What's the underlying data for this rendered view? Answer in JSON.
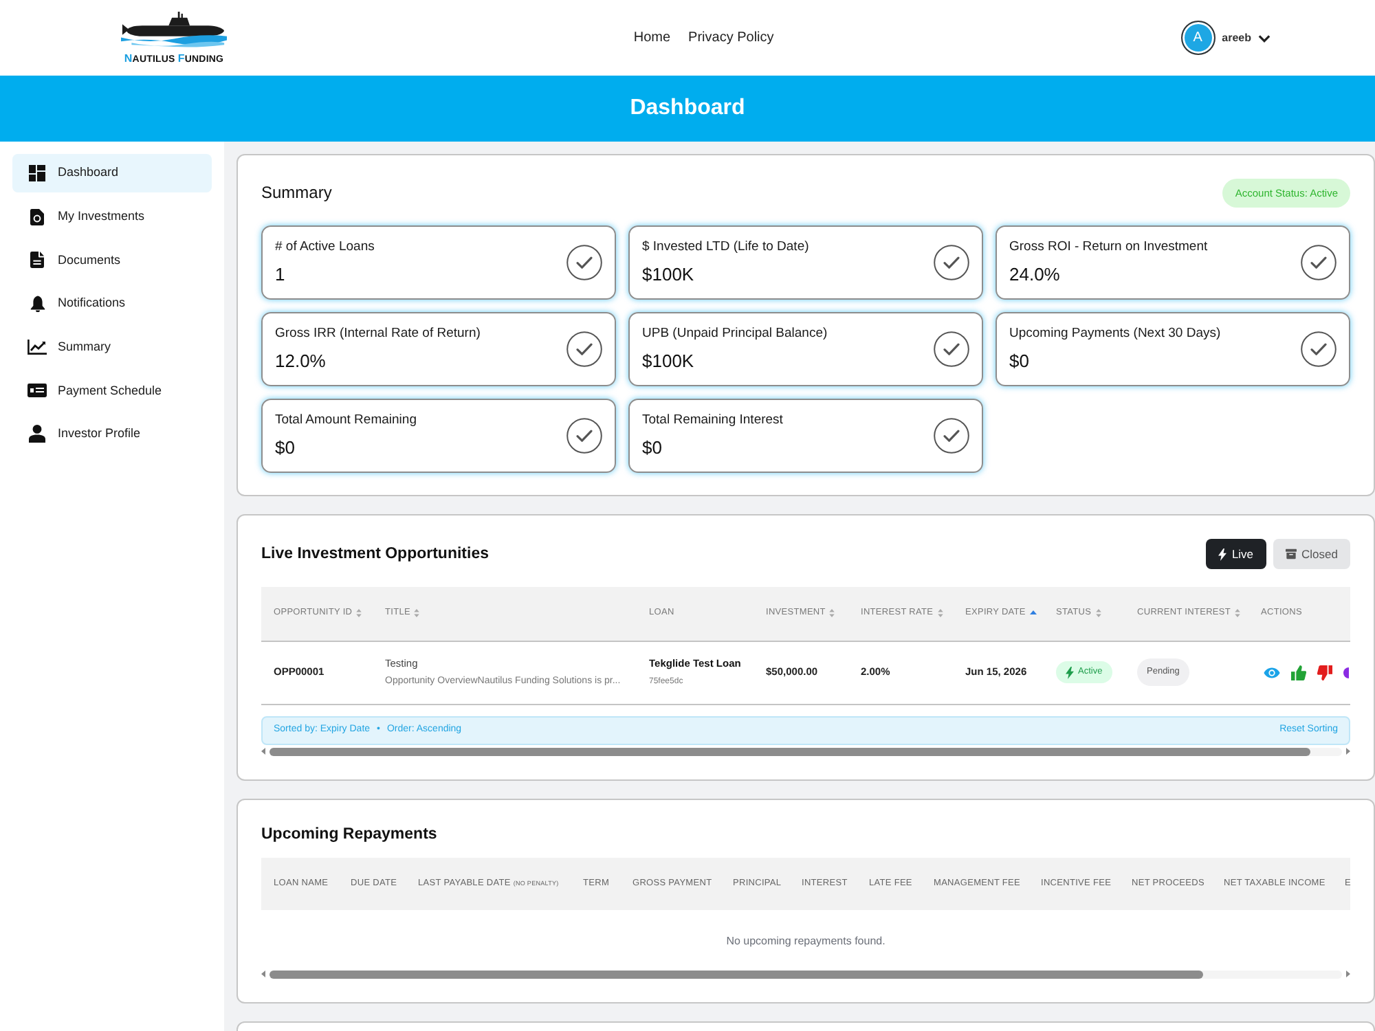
{
  "header": {
    "logo": {
      "words": [
        {
          "initial": "N",
          "rest": "AUTILUS"
        },
        {
          "initial": "F",
          "rest": "UNDING"
        }
      ]
    },
    "nav": [
      {
        "label": "Home"
      },
      {
        "label": "Privacy Policy"
      }
    ],
    "user": {
      "initial": "A",
      "name": "areeb"
    }
  },
  "banner": {
    "title": "Dashboard"
  },
  "sidebar": {
    "items": [
      {
        "label": "Dashboard",
        "selected": true
      },
      {
        "label": "My Investments",
        "selected": false
      },
      {
        "label": "Documents",
        "selected": false
      },
      {
        "label": "Notifications",
        "selected": false
      },
      {
        "label": "Summary",
        "selected": false
      },
      {
        "label": "Payment Schedule",
        "selected": false
      },
      {
        "label": "Investor Profile",
        "selected": false
      }
    ]
  },
  "summary": {
    "title": "Summary",
    "account_status": "Account Status: Active",
    "stats": [
      {
        "label": "# of Active Loans",
        "value": "1"
      },
      {
        "label": "$ Invested LTD (Life to Date)",
        "value": "$100K"
      },
      {
        "label": "Gross ROI - Return on Investment",
        "value": "24.0%"
      },
      {
        "label": "Gross IRR (Internal Rate of Return)",
        "value": "12.0%"
      },
      {
        "label": "UPB (Unpaid Principal Balance)",
        "value": "$100K"
      },
      {
        "label": "Upcoming Payments (Next 30 Days)",
        "value": "$0"
      },
      {
        "label": "Total Amount Remaining",
        "value": "$0"
      },
      {
        "label": "Total Remaining Interest",
        "value": "$0"
      }
    ]
  },
  "live_opportunities": {
    "title": "Live Investment Opportunities",
    "filters": [
      {
        "label": "Live",
        "selected": true
      },
      {
        "label": "Closed",
        "selected": false
      }
    ],
    "columns": [
      {
        "label": "OPPORTUNITY ID",
        "sortable": true,
        "sorted": false
      },
      {
        "label": "TITLE",
        "sortable": true,
        "sorted": false
      },
      {
        "label": "LOAN",
        "sortable": false,
        "sorted": false
      },
      {
        "label": "INVESTMENT",
        "sortable": true,
        "sorted": false
      },
      {
        "label": "INTEREST RATE",
        "sortable": true,
        "sorted": false
      },
      {
        "label": "EXPIRY DATE",
        "sortable": true,
        "sorted": true
      },
      {
        "label": "STATUS",
        "sortable": true,
        "sorted": false
      },
      {
        "label": "CURRENT INTEREST",
        "sortable": true,
        "sorted": false
      },
      {
        "label": "ACTIONS",
        "sortable": false,
        "sorted": false
      }
    ],
    "rows": [
      {
        "opportunity_id": "OPP00001",
        "title": "Testing",
        "summary": "Opportunity OverviewNautilus Funding Solutions is pr...",
        "loan_name": "Tekglide Test Loan",
        "loan_code": "75fee5dc",
        "investment": "$50,000.00",
        "interest_rate": "2.00%",
        "expiry_date": "Jun 15, 2026",
        "status": {
          "label": "Active",
          "kind": "active"
        },
        "current_interest": {
          "label": "Pending",
          "kind": "pending"
        }
      }
    ],
    "sort_info": {
      "sorted_by": "Sorted by: Expiry Date",
      "separator": "•",
      "order": "Order: Ascending",
      "reset": "Reset Sorting"
    }
  },
  "upcoming_repayments": {
    "title": "Upcoming Repayments",
    "columns": [
      {
        "label": "LOAN NAME"
      },
      {
        "label": "DUE DATE"
      },
      {
        "label": "LAST PAYABLE DATE",
        "note": "(NO PENALTY)"
      },
      {
        "label": "TERM"
      },
      {
        "label": "GROSS PAYMENT"
      },
      {
        "label": "PRINCIPAL"
      },
      {
        "label": "INTEREST"
      },
      {
        "label": "LATE FEE"
      },
      {
        "label": "MANAGEMENT FEE"
      },
      {
        "label": "INCENTIVE FEE"
      },
      {
        "label": "NET PROCEEDS"
      },
      {
        "label": "NET TAXABLE INCOME"
      },
      {
        "label": "E"
      }
    ],
    "empty_message": "No upcoming repayments found."
  }
}
